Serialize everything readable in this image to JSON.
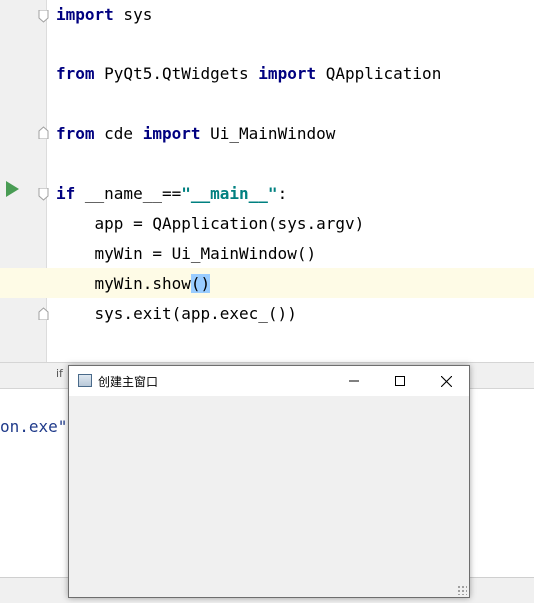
{
  "editor": {
    "lines": {
      "l1_kw": "import",
      "l1_rest": " sys",
      "l2_kw1": "from",
      "l2_mod": " PyQt5.QtWidgets ",
      "l2_kw2": "import",
      "l2_rest": " QApplication",
      "l3_kw1": "from",
      "l3_mod": " cde ",
      "l3_kw2": "import",
      "l3_rest": " Ui_MainWindow",
      "l4_kw": "if",
      "l4_name": " __name__==",
      "l4_str": "\"__main__\"",
      "l4_colon": ":",
      "l5": "    app = QApplication(sys.argv)",
      "l6": "    myWin = Ui_MainWindow()",
      "l7_a": "    myWin.show",
      "l7_paren": "()",
      "l8": "    sys.exit(app.exec_())"
    }
  },
  "status": {
    "breadcrumb": "if"
  },
  "console": {
    "output_fragment": "on.exe\""
  },
  "window": {
    "title": "创建主窗口",
    "minimize": "—",
    "maximize": "☐",
    "close": "✕"
  },
  "colors": {
    "keyword": "#000080",
    "string": "#008080",
    "highlight_line": "#fefbe6",
    "run": "#499c54"
  }
}
